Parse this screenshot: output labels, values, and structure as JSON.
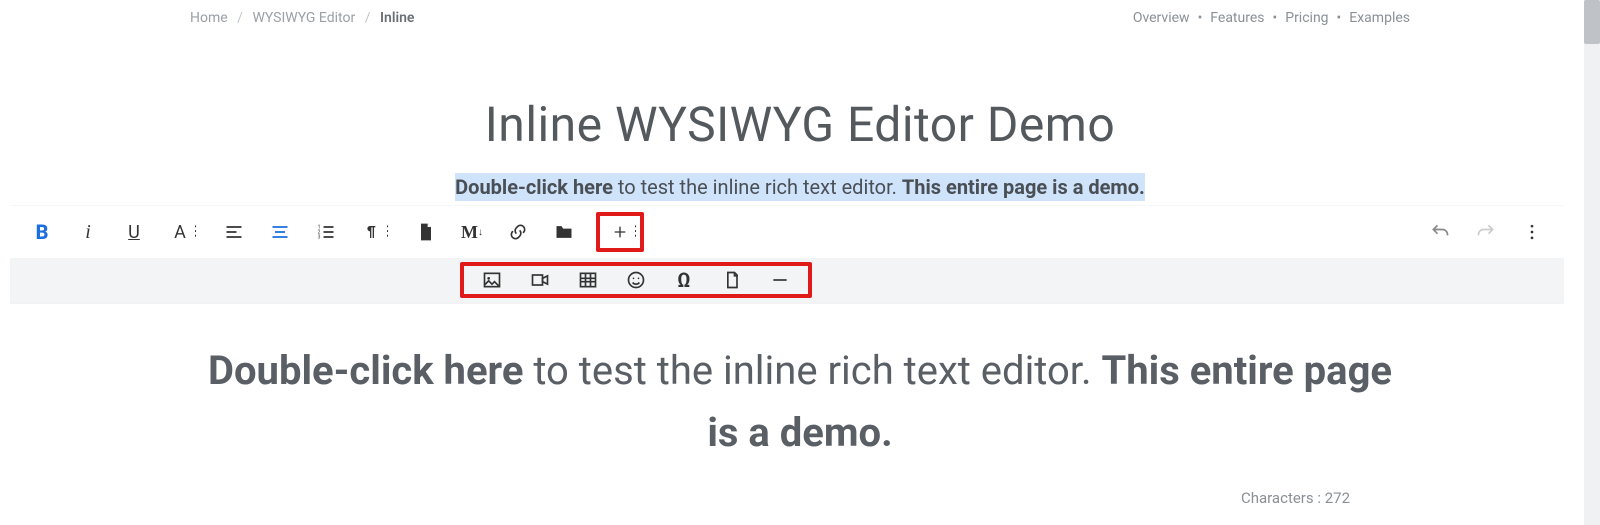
{
  "breadcrumb": {
    "home": "Home",
    "mid": "WYSIWYG Editor",
    "current": "Inline"
  },
  "topnav": {
    "overview": "Overview",
    "features": "Features",
    "pricing": "Pricing",
    "examples": "Examples"
  },
  "headline": "Inline WYSIWYG Editor Demo",
  "selected_paragraph": {
    "bold1": "Double-click here",
    "mid": " to test the inline rich text editor. ",
    "bold2": "This entire page is a demo."
  },
  "toolbar": {
    "bold": "B",
    "italic": "i",
    "underline": "U",
    "textformat": "A",
    "markdown": "M"
  },
  "ghost_line": "page is a demo.",
  "big_paragraph": {
    "bold1": "Double-click here",
    "mid": " to test the inline rich text editor. ",
    "bold2": "This entire page is a demo."
  },
  "charcount": {
    "label": "Characters : ",
    "value": "272"
  }
}
